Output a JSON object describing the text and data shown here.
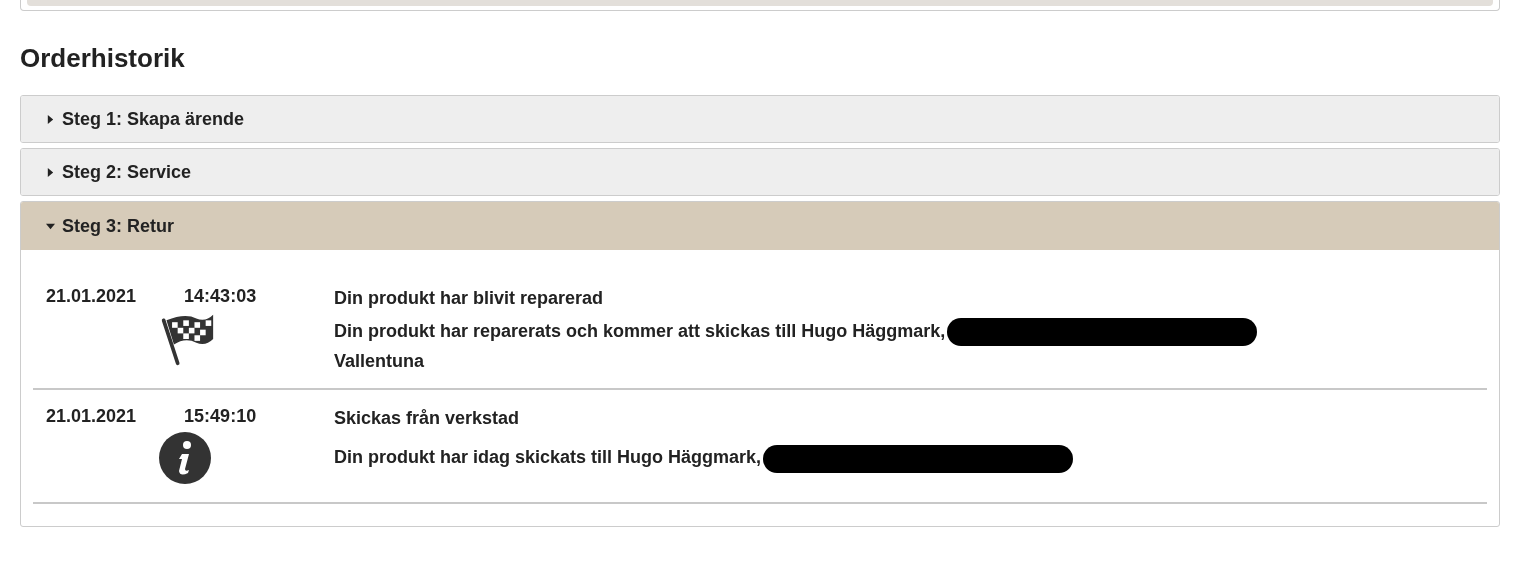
{
  "title": "Orderhistorik",
  "steps": [
    {
      "label": "Steg 1: Skapa ärende",
      "expanded": false
    },
    {
      "label": "Steg 2: Service",
      "expanded": false
    },
    {
      "label": "Steg 3: Retur",
      "expanded": true,
      "events": [
        {
          "date": "21.01.2021",
          "time": "14:43:03",
          "kind": "flag",
          "title": "Din produkt har blivit reparerad",
          "detail": "Din produkt har reparerats och kommer att skickas till Hugo Häggmark,",
          "redacted": true,
          "detail_after": "Vallentuna"
        },
        {
          "date": "21.01.2021",
          "time": "15:49:10",
          "kind": "info",
          "title": "Skickas från verkstad",
          "detail": "Din produkt har idag skickats till Hugo Häggmark,",
          "redacted": true
        }
      ]
    }
  ]
}
